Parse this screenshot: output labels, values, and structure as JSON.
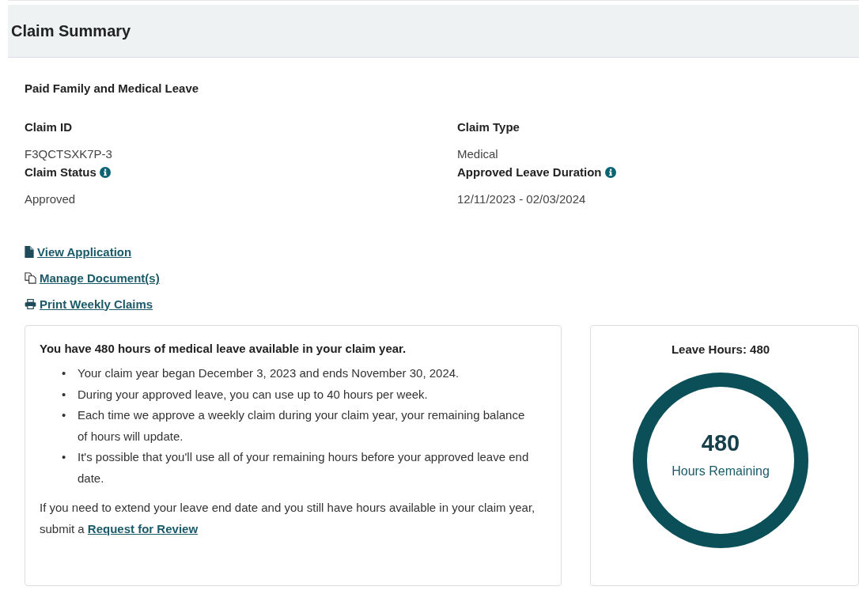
{
  "header": {
    "title": "Claim Summary"
  },
  "program": "Paid Family and Medical Leave",
  "fields": [
    {
      "label": "Claim ID",
      "value": "F3QCTSXK7P-3",
      "info": false
    },
    {
      "label": "Claim Type",
      "value": "Medical",
      "info": false
    },
    {
      "label": "Claim Status",
      "value": "Approved",
      "info": true
    },
    {
      "label": "Approved Leave Duration",
      "value": "12/11/2023 - 02/03/2024",
      "info": true
    }
  ],
  "links": [
    {
      "label": "View Application",
      "kind": "file"
    },
    {
      "label": "Manage Document(s)",
      "kind": "copy"
    },
    {
      "label": "Print Weekly Claims",
      "kind": "print"
    }
  ],
  "info_card": {
    "heading": "You have 480 hours of medical leave available in your claim year.",
    "bullet_marker": "•",
    "bullets": [
      "Your claim year began December 3, 2023 and ends November 30, 2024.",
      "During your approved leave, you can use up to 40 hours per week.",
      "Each time we approve a weekly claim during your claim year, your remaining balance of hours will update.",
      "It's possible that you'll use all of your remaining hours before your approved leave end date."
    ],
    "footer_text": "If you need to extend your leave end date and you still have hours available in your claim year, submit a",
    "footer_link": "Request for Review"
  },
  "hours_card": {
    "title": "Leave Hours: 480",
    "value": "480",
    "caption": "Hours Remaining",
    "level": 1
  }
}
